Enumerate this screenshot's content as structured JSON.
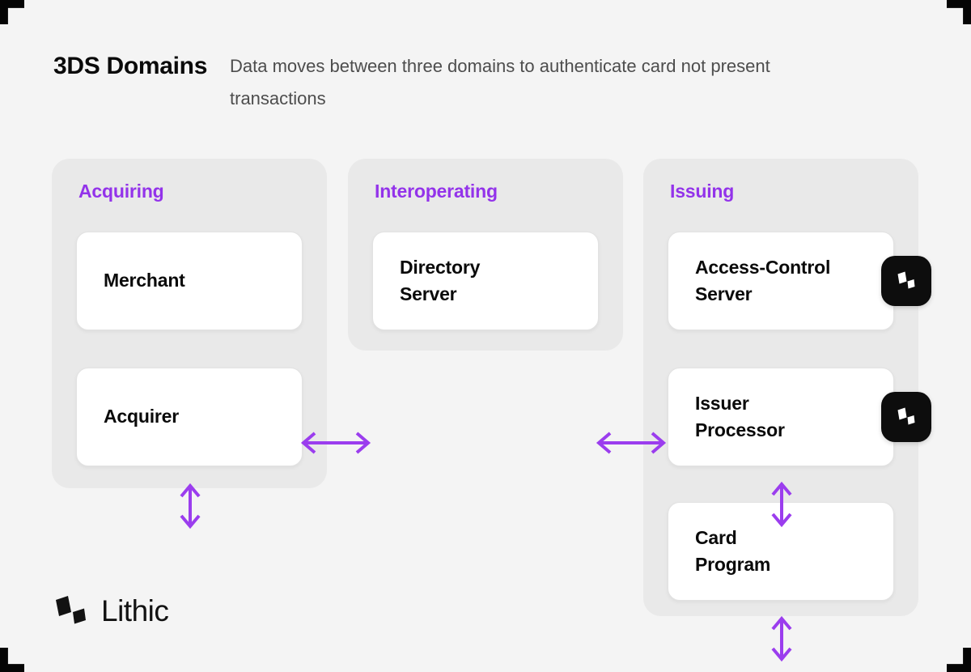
{
  "header": {
    "title": "3DS\nDomains",
    "subtitle": "Data moves between three domains to authenticate card not present transactions"
  },
  "colors": {
    "accent_purple": "#9333ea",
    "arrow_purple": "#9b3dee",
    "panel_bg": "#e9e9e9",
    "page_bg": "#f4f4f4",
    "card_bg": "#ffffff",
    "badge_bg": "#0d0d0d",
    "title_text": "#0a0a0a",
    "subtitle_text": "#4d4d4d"
  },
  "panels": [
    {
      "id": "acquiring",
      "title": "Acquiring",
      "nodes": [
        {
          "id": "merchant",
          "label": "Merchant",
          "has_badge": false
        },
        {
          "id": "acquirer",
          "label": "Acquirer",
          "has_badge": false
        }
      ]
    },
    {
      "id": "interoperating",
      "title": "Interoperating",
      "nodes": [
        {
          "id": "directory-server",
          "label": "Directory\nServer",
          "has_badge": false
        }
      ]
    },
    {
      "id": "issuing",
      "title": "Issuing",
      "nodes": [
        {
          "id": "access-control-server",
          "label": "Access-Control\nServer",
          "has_badge": true
        },
        {
          "id": "issuer-processor",
          "label": "Issuer\nProcessor",
          "has_badge": true
        },
        {
          "id": "card-program",
          "label": "Card\nProgram",
          "has_badge": false
        }
      ]
    }
  ],
  "connections": [
    {
      "id": "merchant-directory",
      "from": "merchant",
      "to": "directory-server",
      "orientation": "horizontal",
      "direction": "bidirectional"
    },
    {
      "id": "directory-acs",
      "from": "directory-server",
      "to": "access-control-server",
      "orientation": "horizontal",
      "direction": "bidirectional"
    },
    {
      "id": "merchant-acquirer",
      "from": "merchant",
      "to": "acquirer",
      "orientation": "vertical",
      "direction": "bidirectional"
    },
    {
      "id": "acs-issuerprocessor",
      "from": "access-control-server",
      "to": "issuer-processor",
      "orientation": "vertical",
      "direction": "bidirectional"
    },
    {
      "id": "issuerprocessor-cardprogram",
      "from": "issuer-processor",
      "to": "card-program",
      "orientation": "vertical",
      "direction": "bidirectional"
    }
  ],
  "badges": {
    "icon_name": "lithic-logo-icon",
    "count": 2
  },
  "footer": {
    "brand": "Lithic",
    "icon_name": "lithic-logo-icon"
  }
}
